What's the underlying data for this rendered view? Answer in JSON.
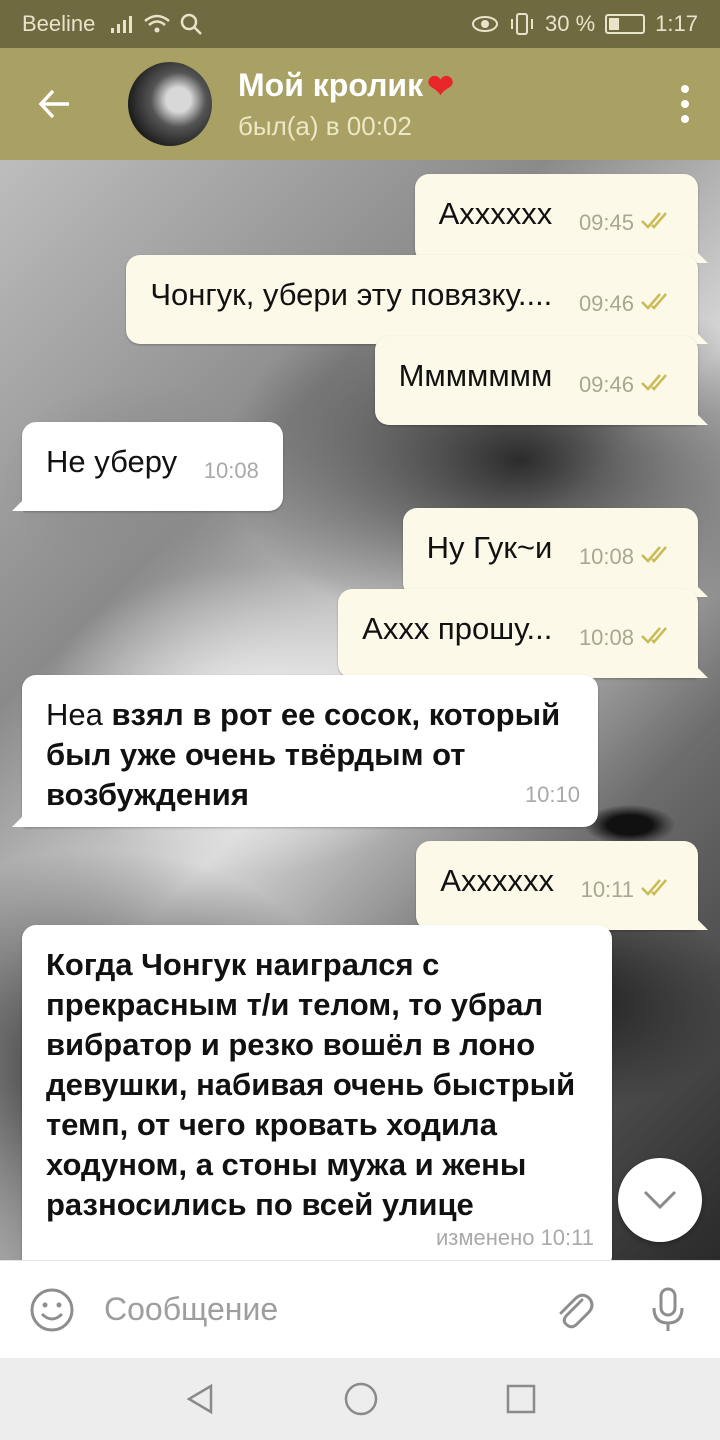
{
  "status_bar": {
    "carrier": "Beeline",
    "battery": "30 %",
    "battery_level": 0.3,
    "time": "1:17"
  },
  "header": {
    "chat_name": "Мой кролик",
    "chat_name_emoji": "❤",
    "status": "был(а) в 00:02"
  },
  "messages": [
    {
      "direction": "out",
      "text": "Axxxxxx",
      "time": "09:45",
      "read": true
    },
    {
      "direction": "out",
      "text": "Чонгук, убери эту повязку....",
      "time": "09:46",
      "read": true
    },
    {
      "direction": "out",
      "text": "Ммммммм",
      "time": "09:46",
      "read": true
    },
    {
      "direction": "in",
      "text": "Не уберу",
      "time": "10:08"
    },
    {
      "direction": "out",
      "text": "Ну Гук~и",
      "time": "10:08",
      "read": true
    },
    {
      "direction": "out",
      "text": "Аxxx прошу...",
      "time": "10:08",
      "read": true
    },
    {
      "direction": "in",
      "text_plain": "Неа ",
      "text_bold": "взял в рот ее сосок, который был уже очень твёрдым от возбуждения",
      "time": "10:10"
    },
    {
      "direction": "out",
      "text": "Axxxxxx",
      "time": "10:11",
      "read": true
    },
    {
      "direction": "in",
      "text_bold": "Когда Чонгук наигрался с прекрасным т/и телом, то убрал вибратор и резко вошёл в лоно девушки, набивая очень быстрый темп, от чего кровать ходила ходуном, а стоны мужа и жены разносились по всей улице",
      "edited": "изменено 10:11"
    }
  ],
  "input": {
    "placeholder": "Сообщение"
  },
  "icons": {
    "back": "arrow-left-icon",
    "menu": "more-vertical-icon",
    "emoji": "smile-icon",
    "attach": "paperclip-icon",
    "mic": "microphone-icon",
    "scroll": "chevron-down-icon"
  },
  "colors": {
    "header": "#a9a163",
    "status_bar": "#6f6a3f",
    "outgoing_bubble": "#fdf9e8",
    "incoming_bubble": "#ffffff",
    "checkmarks": "#c9bb56"
  }
}
